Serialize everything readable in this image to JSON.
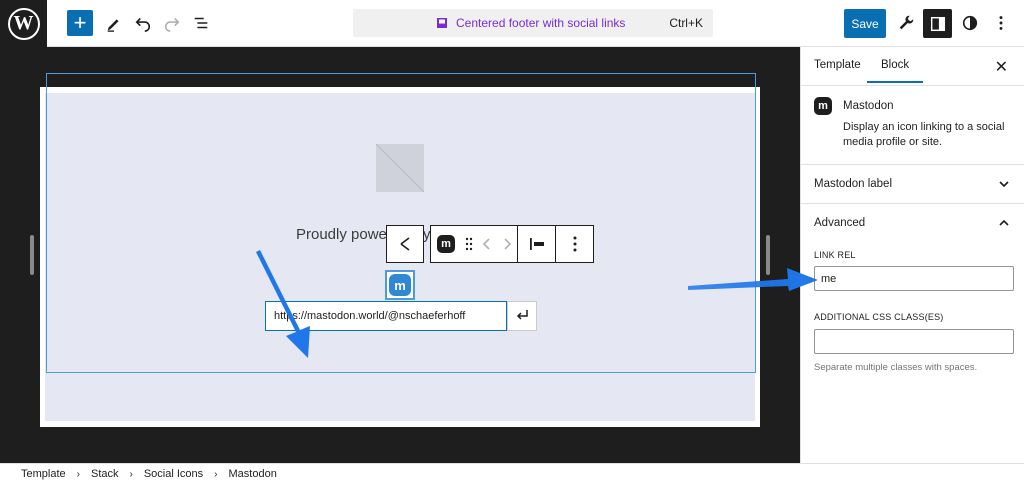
{
  "header": {
    "document_title": "Centered footer with social links",
    "shortcut": "Ctrl+K",
    "save_label": "Save"
  },
  "canvas": {
    "footer_text": "Proudly powe",
    "footer_text_tail": "y",
    "link_url": "https://mastodon.world/@nschaeferhoff"
  },
  "sidebar": {
    "tabs": [
      "Template",
      "Block"
    ],
    "active_tab": "Block",
    "block_name": "Mastodon",
    "block_description": "Display an icon linking to a social media profile or site.",
    "panels": {
      "label_panel": "Mastodon label",
      "advanced_panel": "Advanced"
    },
    "link_rel_label": "LINK REL",
    "link_rel_value": "me",
    "css_class_label": "ADDITIONAL CSS CLASS(ES)",
    "css_class_value": "",
    "css_class_help": "Separate multiple classes with spaces."
  },
  "breadcrumb": [
    "Template",
    "Stack",
    "Social Icons",
    "Mastodon"
  ],
  "colors": {
    "accent": "#0a6fb2",
    "mastodon": "#3088d4",
    "annotation_arrow": "#1f77ea",
    "command_text": "#7a2bd6"
  }
}
